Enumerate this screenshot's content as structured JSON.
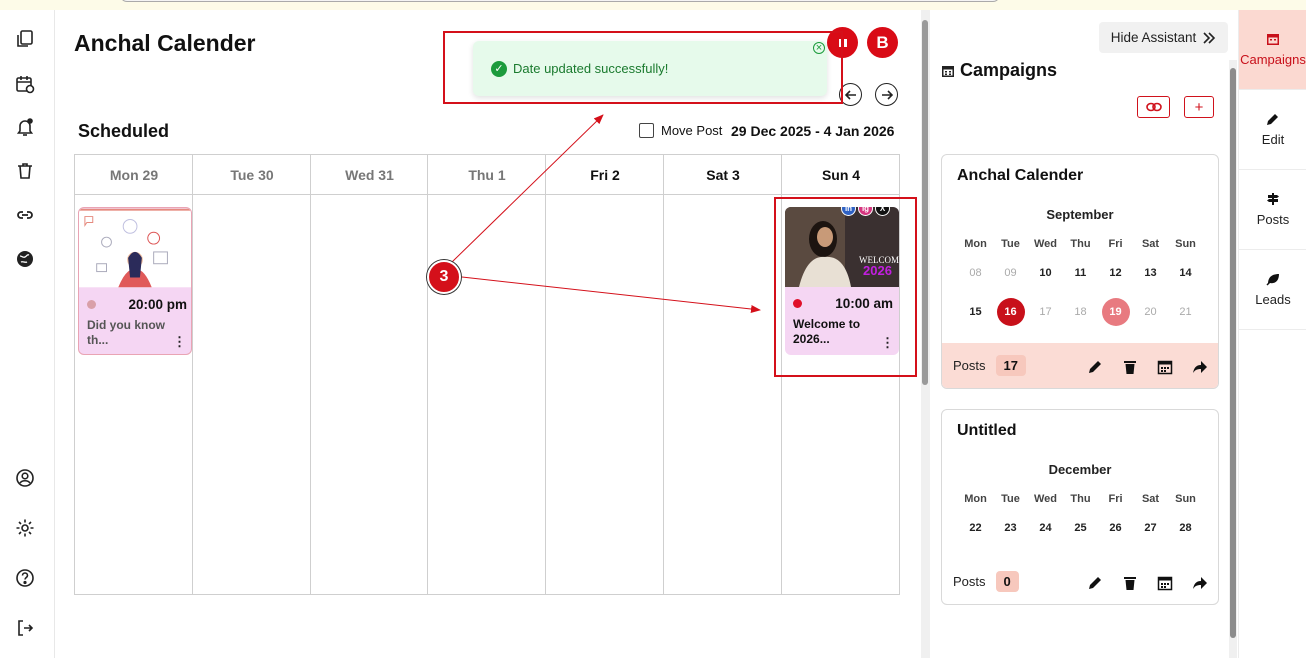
{
  "page": {
    "title": "Anchal Calender"
  },
  "header": {
    "avatar_letter": "B"
  },
  "toast": {
    "message": "Date updated successfully!"
  },
  "calendar": {
    "section_title": "Scheduled",
    "move_post_label": "Move Post",
    "date_range": "29 Dec 2025 - 4 Jan 2026",
    "days": [
      "Mon 29",
      "Tue 30",
      "Wed 31",
      "Thu 1",
      "Fri 2",
      "Sat 3",
      "Sun 4"
    ],
    "posts": [
      {
        "day": "Mon 29",
        "time": "20:00 pm",
        "caption": "Did you know th...",
        "status_color": "#d9a0a8"
      },
      {
        "day": "Sun 4",
        "time": "10:00 am",
        "caption": "Welcome to 2026...",
        "status_color": "#e0102a",
        "networks": [
          "in",
          "ig",
          "X"
        ]
      }
    ]
  },
  "annotation": {
    "number": "3"
  },
  "assistant": {
    "hide_label": "Hide Assistant",
    "campaigns_title": "Campaigns",
    "weekday_labels": [
      "Mon",
      "Tue",
      "Wed",
      "Thu",
      "Fri",
      "Sat",
      "Sun"
    ],
    "campaigns": [
      {
        "name": "Anchal Calender",
        "month": "September",
        "weeks": [
          [
            "08",
            "09",
            "10",
            "11",
            "12",
            "13",
            "14"
          ],
          [
            "15",
            "16",
            "17",
            "18",
            "19",
            "20",
            "21"
          ]
        ],
        "posts_label": "Posts",
        "posts_count": "17"
      },
      {
        "name": "Untitled",
        "month": "December",
        "weeks": [
          [
            "22",
            "23",
            "24",
            "25",
            "26",
            "27",
            "28"
          ]
        ],
        "posts_label": "Posts",
        "posts_count": "0"
      }
    ]
  },
  "rail": {
    "items": [
      {
        "label": "Campaigns"
      },
      {
        "label": "Edit"
      },
      {
        "label": "Posts"
      },
      {
        "label": "Leads"
      }
    ]
  },
  "colors": {
    "accent": "#c8101a",
    "toast_bg": "#e6faeb",
    "post_bg": "#f5d6f3"
  }
}
